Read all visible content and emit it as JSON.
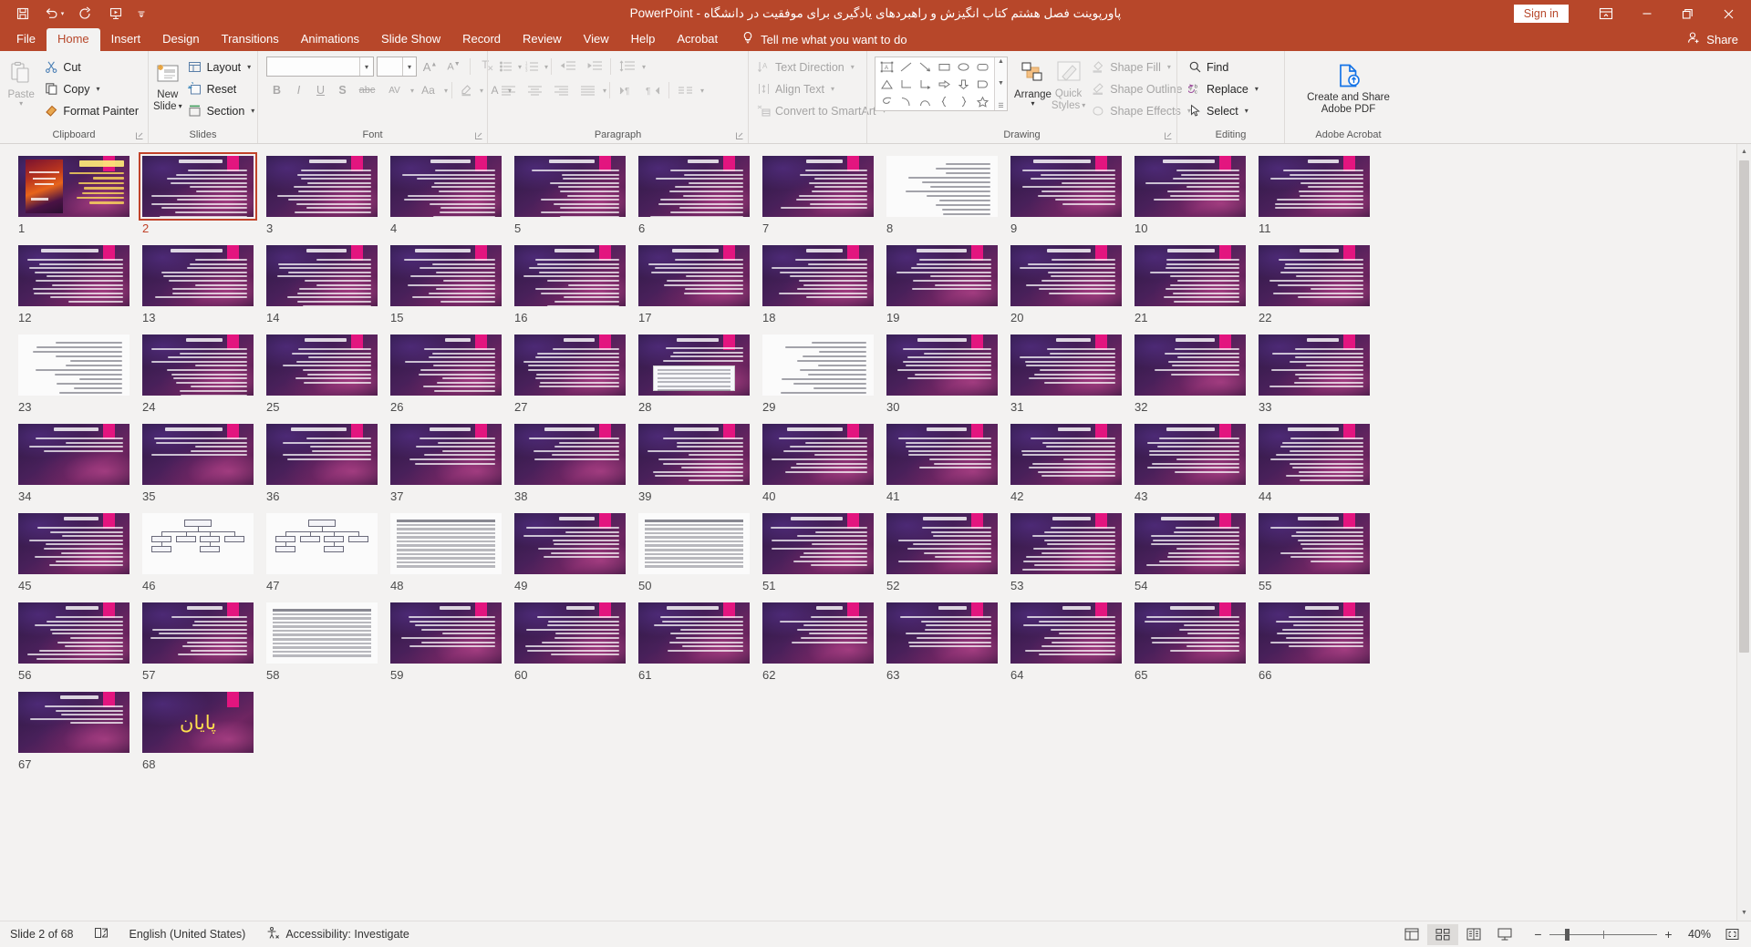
{
  "titlebar": {
    "document_title": "پاورپوینت فصل هشتم کتاب انگیزش و راهبردهای یادگیری برای موفقیت در دانشگاه",
    "app_name": "PowerPoint",
    "title_full": "پاورپوینت فصل هشتم کتاب انگیزش و راهبردهای یادگیری برای موفقیت در دانشگاه  -  PowerPoint",
    "signin_label": "Sign in",
    "quick_access": [
      {
        "name": "save-icon",
        "tooltip": "Save"
      },
      {
        "name": "undo-icon",
        "tooltip": "Undo"
      },
      {
        "name": "redo-icon",
        "tooltip": "Redo"
      },
      {
        "name": "start-from-beginning-icon",
        "tooltip": "Start From Beginning"
      },
      {
        "name": "customize-quick-access-toolbar-icon",
        "tooltip": "Customize Quick Access Toolbar"
      }
    ],
    "window_controls": [
      "ribbon-display-options",
      "minimize",
      "restore",
      "close"
    ],
    "accent_color": "#b7472a"
  },
  "tabs": [
    {
      "label": "File",
      "active": false
    },
    {
      "label": "Home",
      "active": true
    },
    {
      "label": "Insert",
      "active": false
    },
    {
      "label": "Design",
      "active": false
    },
    {
      "label": "Transitions",
      "active": false
    },
    {
      "label": "Animations",
      "active": false
    },
    {
      "label": "Slide Show",
      "active": false
    },
    {
      "label": "Record",
      "active": false
    },
    {
      "label": "Review",
      "active": false
    },
    {
      "label": "View",
      "active": false
    },
    {
      "label": "Help",
      "active": false
    },
    {
      "label": "Acrobat",
      "active": false
    }
  ],
  "tell_me": {
    "label": "Tell me what you want to do",
    "icon": "lightbulb-icon"
  },
  "share": {
    "label": "Share",
    "icon": "share-person-icon"
  },
  "ribbon": {
    "clipboard": {
      "label": "Clipboard",
      "paste": "Paste",
      "items": [
        {
          "label": "Cut",
          "icon": "scissors-icon"
        },
        {
          "label": "Copy",
          "icon": "copy-icon"
        },
        {
          "label": "Format Painter",
          "icon": "format-painter-icon"
        }
      ]
    },
    "slides": {
      "label": "Slides",
      "new_slide": "New Slide",
      "items": [
        {
          "label": "Layout",
          "icon": "layout-icon"
        },
        {
          "label": "Reset",
          "icon": "reset-icon"
        },
        {
          "label": "Section",
          "icon": "section-icon"
        }
      ]
    },
    "font": {
      "label": "Font",
      "font_name_value": "",
      "font_name_placeholder": "",
      "font_size_value": "",
      "buttons": [
        "B",
        "I",
        "U",
        "S",
        "abc"
      ],
      "char_spacing": "AV",
      "change_case": "Aa",
      "increase_font": "A",
      "decrease_font": "A",
      "clear_formatting": "clear-formatting-icon",
      "text_highlight": "text-highlight-icon",
      "font_color": "A"
    },
    "paragraph": {
      "label": "Paragraph",
      "items": [
        "bullets",
        "numbering",
        "decrease-indent",
        "increase-indent",
        "line-spacing",
        "align-left",
        "align-center",
        "align-right",
        "justify",
        "ltr-text-direction",
        "rtl-text-direction",
        "columns"
      ],
      "text_direction": "Text Direction",
      "align_text": "Align Text",
      "convert_to_smartart": "Convert to SmartArt"
    },
    "drawing": {
      "label": "Drawing",
      "arrange": "Arrange",
      "quick_styles_line1": "Quick",
      "quick_styles_line2": "Styles",
      "shape_fill": "Shape Fill",
      "shape_outline": "Shape Outline",
      "shape_effects": "Shape Effects"
    },
    "editing": {
      "label": "Editing",
      "items": [
        {
          "label": "Find",
          "icon": "search-icon"
        },
        {
          "label": "Replace",
          "icon": "replace-icon"
        },
        {
          "label": "Select",
          "icon": "select-cursor-icon"
        }
      ]
    },
    "adobe": {
      "label": "Adobe Acrobat",
      "line1": "Create and Share",
      "line2": "Adobe PDF",
      "icon": "pdf-upload-icon"
    }
  },
  "sorter": {
    "selected_slide": 2,
    "total_slides": 68,
    "slides": [
      {
        "n": 1,
        "kind": "cover"
      },
      {
        "n": 2,
        "kind": "text",
        "lines": 15,
        "selected": true
      },
      {
        "n": 3,
        "kind": "text",
        "lines": 11
      },
      {
        "n": 4,
        "kind": "text",
        "lines": 12
      },
      {
        "n": 5,
        "kind": "text",
        "lines": 13
      },
      {
        "n": 6,
        "kind": "text",
        "lines": 14
      },
      {
        "n": 7,
        "kind": "text",
        "lines": 10
      },
      {
        "n": 8,
        "kind": "doc"
      },
      {
        "n": 9,
        "kind": "text",
        "lines": 9
      },
      {
        "n": 10,
        "kind": "text",
        "lines": 8
      },
      {
        "n": 11,
        "kind": "text",
        "lines": 10
      },
      {
        "n": 12,
        "kind": "text",
        "lines": 11
      },
      {
        "n": 13,
        "kind": "text",
        "lines": 10
      },
      {
        "n": 14,
        "kind": "text",
        "lines": 12
      },
      {
        "n": 15,
        "kind": "text",
        "lines": 11
      },
      {
        "n": 16,
        "kind": "text",
        "lines": 13
      },
      {
        "n": 17,
        "kind": "text",
        "lines": 9
      },
      {
        "n": 18,
        "kind": "text",
        "lines": 10
      },
      {
        "n": 19,
        "kind": "text",
        "lines": 8
      },
      {
        "n": 20,
        "kind": "text",
        "lines": 9
      },
      {
        "n": 21,
        "kind": "text",
        "lines": 11
      },
      {
        "n": 22,
        "kind": "text",
        "lines": 10
      },
      {
        "n": 23,
        "kind": "doc"
      },
      {
        "n": 24,
        "kind": "text",
        "lines": 12
      },
      {
        "n": 25,
        "kind": "text",
        "lines": 9
      },
      {
        "n": 26,
        "kind": "text",
        "lines": 11
      },
      {
        "n": 27,
        "kind": "text",
        "lines": 10
      },
      {
        "n": 28,
        "kind": "mixed"
      },
      {
        "n": 29,
        "kind": "doc"
      },
      {
        "n": 30,
        "kind": "text",
        "lines": 8
      },
      {
        "n": 31,
        "kind": "text",
        "lines": 9
      },
      {
        "n": 32,
        "kind": "text",
        "lines": 7
      },
      {
        "n": 33,
        "kind": "text",
        "lines": 10
      },
      {
        "n": 34,
        "kind": "text",
        "lines": 4
      },
      {
        "n": 35,
        "kind": "text",
        "lines": 5
      },
      {
        "n": 36,
        "kind": "text",
        "lines": 6
      },
      {
        "n": 37,
        "kind": "text",
        "lines": 7
      },
      {
        "n": 38,
        "kind": "text",
        "lines": 6
      },
      {
        "n": 39,
        "kind": "text",
        "lines": 11
      },
      {
        "n": 40,
        "kind": "text",
        "lines": 9
      },
      {
        "n": 41,
        "kind": "text",
        "lines": 8
      },
      {
        "n": 42,
        "kind": "text",
        "lines": 10
      },
      {
        "n": 43,
        "kind": "text",
        "lines": 9
      },
      {
        "n": 44,
        "kind": "text",
        "lines": 11
      },
      {
        "n": 45,
        "kind": "text",
        "lines": 10
      },
      {
        "n": 46,
        "kind": "diagram"
      },
      {
        "n": 47,
        "kind": "diagram"
      },
      {
        "n": 48,
        "kind": "table"
      },
      {
        "n": 49,
        "kind": "text",
        "lines": 8
      },
      {
        "n": 50,
        "kind": "table"
      },
      {
        "n": 51,
        "kind": "text",
        "lines": 10
      },
      {
        "n": 52,
        "kind": "text",
        "lines": 9
      },
      {
        "n": 53,
        "kind": "text",
        "lines": 11
      },
      {
        "n": 54,
        "kind": "text",
        "lines": 10
      },
      {
        "n": 55,
        "kind": "text",
        "lines": 9
      },
      {
        "n": 56,
        "kind": "text",
        "lines": 11
      },
      {
        "n": 57,
        "kind": "text",
        "lines": 10
      },
      {
        "n": 58,
        "kind": "table"
      },
      {
        "n": 59,
        "kind": "text",
        "lines": 8
      },
      {
        "n": 60,
        "kind": "text",
        "lines": 10
      },
      {
        "n": 61,
        "kind": "text",
        "lines": 9
      },
      {
        "n": 62,
        "kind": "text",
        "lines": 7
      },
      {
        "n": 63,
        "kind": "text",
        "lines": 8
      },
      {
        "n": 64,
        "kind": "text",
        "lines": 10
      },
      {
        "n": 65,
        "kind": "text",
        "lines": 9
      },
      {
        "n": 66,
        "kind": "text",
        "lines": 8
      },
      {
        "n": 67,
        "kind": "text",
        "lines": 5
      },
      {
        "n": 68,
        "kind": "end",
        "text": "پایان"
      }
    ]
  },
  "status": {
    "slide_indicator": "Slide 2 of 68",
    "notes_icon": "notes-icon",
    "language": "English (United States)",
    "accessibility": "Accessibility: Investigate",
    "accessibility_icon": "accessibility-icon",
    "views": [
      {
        "name": "normal-view",
        "active": false
      },
      {
        "name": "slide-sorter-view",
        "active": true
      },
      {
        "name": "reading-view",
        "active": false
      },
      {
        "name": "slide-show-view",
        "active": false
      }
    ],
    "zoom_out": "−",
    "zoom_in": "+",
    "zoom_level": "40%",
    "fit_to_window": "fit-slide-to-window-icon"
  }
}
